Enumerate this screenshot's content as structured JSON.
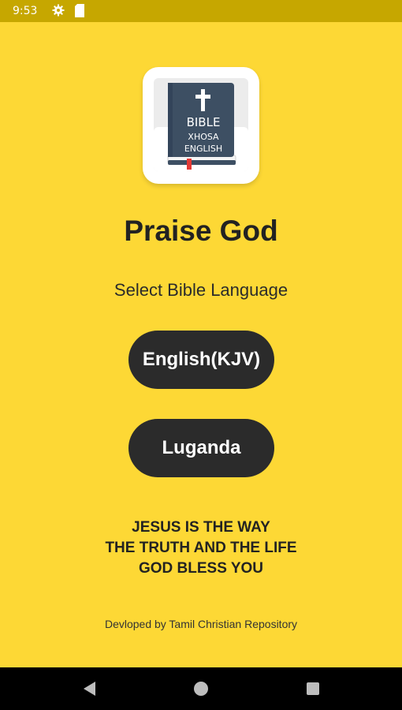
{
  "status_bar": {
    "time": "9:53",
    "icons": [
      "gear-icon",
      "sd-card-icon"
    ],
    "background": "#C6A700"
  },
  "app_icon": {
    "cover_lines": [
      "BIBLE",
      "XHOSA",
      "ENGLISH"
    ],
    "cross": "✝",
    "cover_color": "#3D4F63"
  },
  "main": {
    "title": "Praise God",
    "subtitle": "Select Bible Language",
    "languages": [
      {
        "label": "English(KJV)"
      },
      {
        "label": "Luganda"
      }
    ],
    "verse_lines": [
      "JESUS IS THE WAY",
      "THE TRUTH AND THE LIFE",
      "GOD BLESS YOU"
    ],
    "credit": "Devloped by Tamil Christian Repository"
  },
  "nav_bar": {
    "buttons": [
      "back-icon",
      "home-icon",
      "recents-icon"
    ]
  },
  "colors": {
    "background": "#FDD835",
    "button": "#2B2B2B",
    "button_text": "#FFFFFF"
  }
}
